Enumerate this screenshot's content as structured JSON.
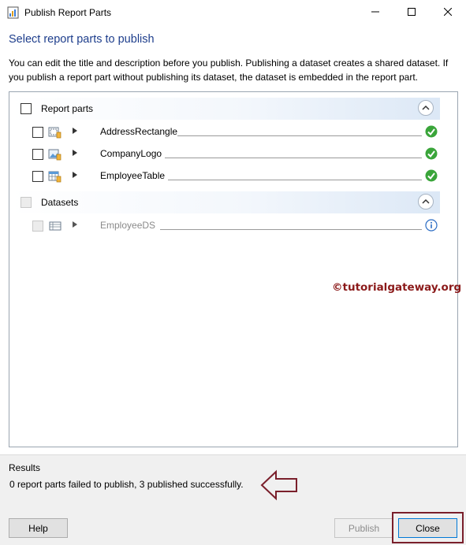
{
  "window": {
    "title": "Publish Report Parts",
    "icon": "report-parts-app-icon"
  },
  "heading": "Select report parts to publish",
  "description": "You can edit the title and description before you publish. Publishing a dataset creates a shared dataset. If you publish a report part without publishing its dataset, the dataset is embedded in the report part.",
  "groups": {
    "report_parts": {
      "label": "Report parts",
      "items": [
        {
          "name": "AddressRectangle",
          "icon": "rectangle-icon",
          "status": "success-check-icon"
        },
        {
          "name": "CompanyLogo",
          "icon": "image-icon",
          "status": "success-check-icon"
        },
        {
          "name": "EmployeeTable",
          "icon": "table-icon",
          "status": "success-check-icon"
        }
      ]
    },
    "datasets": {
      "label": "Datasets",
      "items": [
        {
          "name": "EmployeeDS",
          "icon": "dataset-icon",
          "status": "info-icon"
        }
      ]
    }
  },
  "watermark": "©tutorialgateway.org",
  "results": {
    "title": "Results",
    "message": "0 report parts failed to publish, 3 published successfully."
  },
  "buttons": {
    "help": "Help",
    "publish": "Publish",
    "close": "Close"
  },
  "colors": {
    "heading": "#1e3e8c",
    "success": "#3aa53a",
    "info": "#2b6cc4",
    "annotation": "#7a1f2b",
    "watermark": "#8b1a1a"
  }
}
